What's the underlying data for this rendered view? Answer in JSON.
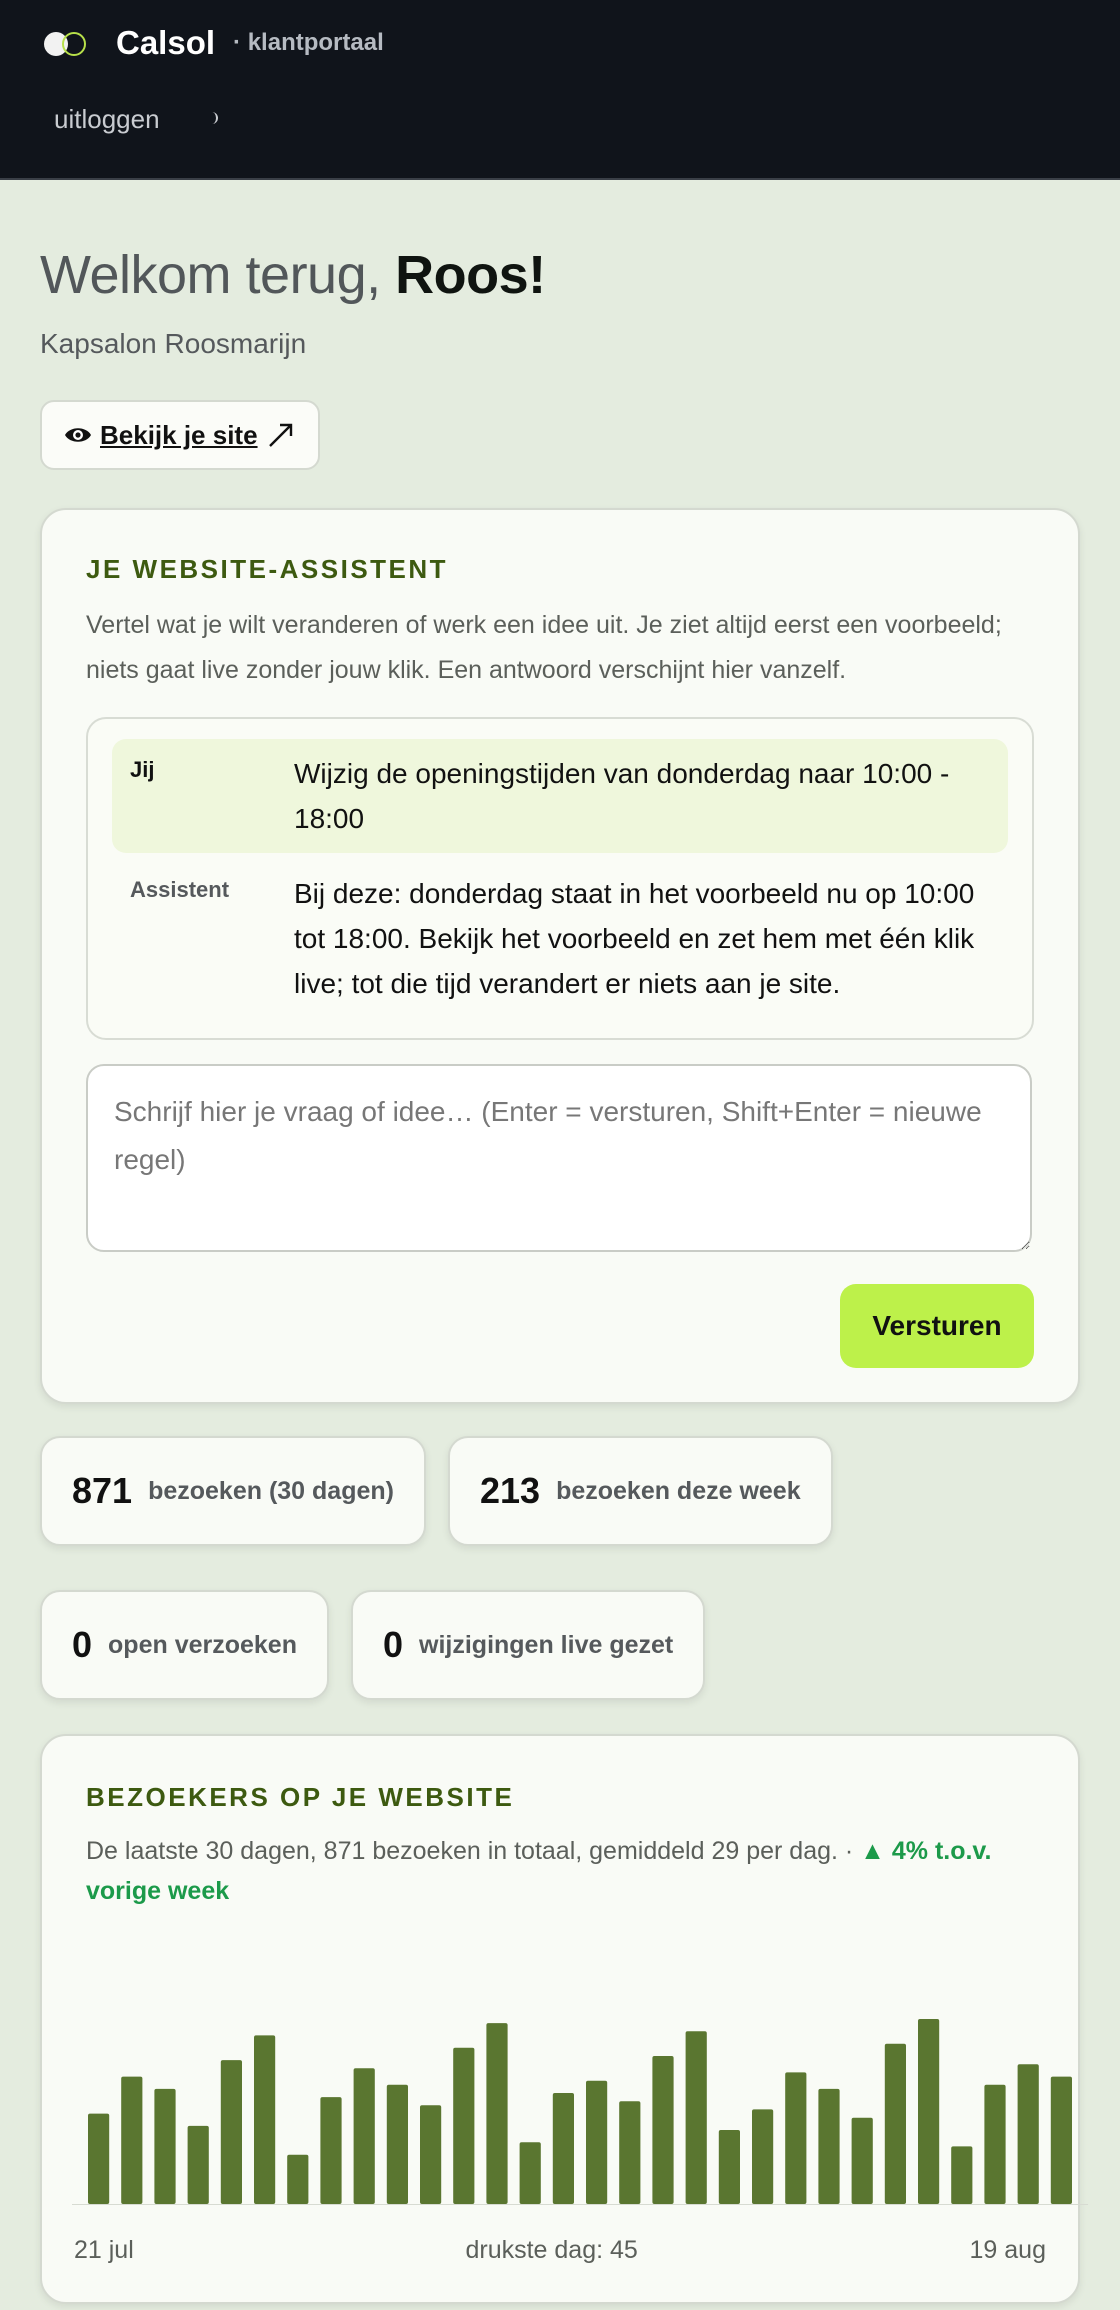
{
  "header": {
    "brand": "Calsol",
    "subtitle": "· klantportaal",
    "logout": "uitloggen"
  },
  "welcome": {
    "greeting": "Welkom terug,",
    "name": "Roos!",
    "company": "Kapsalon Roosmarijn",
    "view_site": "Bekijk je site"
  },
  "assistant": {
    "title": "JE WEBSITE-ASSISTENT",
    "description": "Vertel wat je wilt veranderen of werk een idee uit. Je ziet altijd eerst een voorbeeld; niets gaat live zonder jouw klik. Een antwoord verschijnt hier vanzelf.",
    "messages": [
      {
        "who": "Jij",
        "text": "Wijzig de openingstijden van donderdag naar 10:00 - 18:00"
      },
      {
        "who": "Assistent",
        "text": "Bij deze: donderdag staat in het voorbeeld nu op 10:00 tot 18:00. Bekijk het voorbeeld en zet hem met één klik live; tot die tijd verandert er niets aan je site."
      }
    ],
    "input_placeholder": "Schrijf hier je vraag of idee… (Enter = versturen, Shift+Enter = nieuwe regel)",
    "send": "Versturen"
  },
  "stats": [
    {
      "value": "871",
      "label": "bezoeken (30 dagen)"
    },
    {
      "value": "213",
      "label": "bezoeken deze week"
    },
    {
      "value": "0",
      "label": "open verzoeken"
    },
    {
      "value": "0",
      "label": "wijzigingen live gezet"
    }
  ],
  "visitors": {
    "title": "BEZOEKERS OP JE WEBSITE",
    "description": "De laatste 30 dagen, 871 bezoeken in totaal, gemiddeld 29 per dag. ·",
    "trend": "▲ 4% t.o.v. vorige week",
    "start_label": "21 jul",
    "peak_label": "drukste dag: 45",
    "end_label": "19 aug"
  },
  "colors": {
    "bar": "#5a7630",
    "accent": "#bdf14a",
    "trend": "#1c9a4a"
  },
  "chart_data": {
    "type": "bar",
    "categories": [
      "21 jul",
      "22 jul",
      "23 jul",
      "24 jul",
      "25 jul",
      "26 jul",
      "27 jul",
      "28 jul",
      "29 jul",
      "30 jul",
      "31 jul",
      "1 aug",
      "2 aug",
      "3 aug",
      "4 aug",
      "5 aug",
      "6 aug",
      "7 aug",
      "8 aug",
      "9 aug",
      "10 aug",
      "11 aug",
      "12 aug",
      "13 aug",
      "14 aug",
      "15 aug",
      "16 aug",
      "17 aug",
      "18 aug",
      "19 aug"
    ],
    "values": [
      22,
      31,
      28,
      19,
      35,
      41,
      12,
      26,
      33,
      29,
      24,
      38,
      44,
      15,
      27,
      30,
      25,
      36,
      42,
      18,
      23,
      32,
      28,
      21,
      39,
      45,
      14,
      29,
      34,
      31
    ],
    "ylim": [
      0,
      45
    ]
  }
}
